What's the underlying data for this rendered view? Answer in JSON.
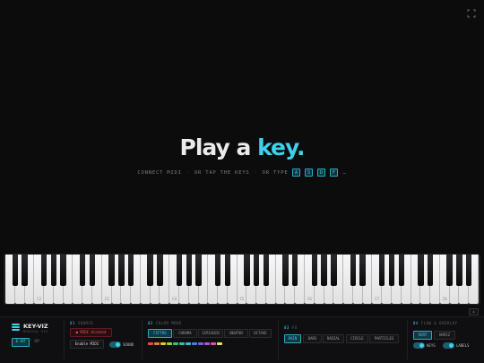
{
  "hero": {
    "title_lead": "Play a ",
    "title_accent": "key.",
    "connect": "CONNECT MIDI",
    "sep": "·",
    "tap": "OR TAP THE KEYS",
    "type": "OR TYPE",
    "keys": [
      "A",
      "S",
      "D",
      "F"
    ],
    "ellipsis": "…"
  },
  "keyboard": {
    "white_key_count": 49,
    "octave_labels": [
      "C2",
      "C3",
      "C4",
      "C5",
      "C6",
      "C7",
      "C8"
    ]
  },
  "panel": {
    "brand": {
      "name": "KEY-VIZ",
      "sub": "MUSICAL VIZ"
    },
    "language": {
      "active": "E·NT",
      "other": "SP"
    },
    "sections": {
      "source": {
        "num": "01",
        "label": "SOURCE",
        "midi_status": "● MIDI blocked",
        "enable_midi": "Enable MIDI",
        "sound_label": "SOUND"
      },
      "color": {
        "num": "02",
        "label": "COLOR MODE",
        "modes": [
          "FIFTHS",
          "CHROMA",
          "SCRIABIN",
          "NEWTON",
          "OCTAVE"
        ],
        "active_mode": "FIFTHS"
      },
      "fx": {
        "num": "03",
        "label": "FX",
        "modes": [
          "RAIN",
          "BARS",
          "RADIAL",
          "CIRCLE",
          "PARTICLES"
        ],
        "active_mode": "RAIN"
      },
      "flow": {
        "num": "04",
        "label": "FLOW & OVERLAY",
        "sides": [
          "VERT",
          "HORIZ"
        ],
        "active_side": "VERT",
        "keys_label": "KEYS",
        "labels_label": "LABELS"
      }
    },
    "palette": [
      "#e2503f",
      "#e57d33",
      "#e7c13a",
      "#9bd13d",
      "#3cc26a",
      "#33c2a8",
      "#3bb7d9",
      "#4a7fe0",
      "#7b5ce0",
      "#b352d8",
      "#e14fae",
      "#e7e26f"
    ]
  },
  "colors": {
    "accent": "#3fd0ea",
    "background": "#0c0c0d",
    "danger": "#e45a63"
  },
  "icons": {
    "fullscreen": "fullscreen-icon",
    "collapse": "chevron-up-icon",
    "logo": "bars-logo-icon"
  }
}
